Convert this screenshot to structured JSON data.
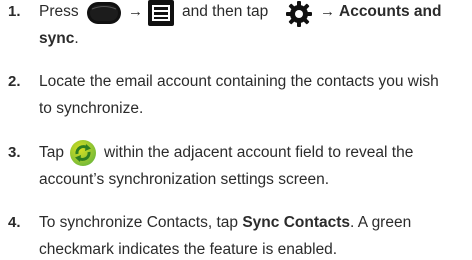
{
  "steps": [
    {
      "number": "1.",
      "press": "Press",
      "arrow1": "→",
      "middle": "and then tap",
      "arrow2": "→",
      "target_a": "Accounts and",
      "target_b": "sync",
      "period": ".",
      "icons": [
        "power-button-icon",
        "menu-key-icon",
        "settings-gear-icon"
      ]
    },
    {
      "number": "2.",
      "line1": "Locate the email account containing the contacts you wish",
      "line2": "to synchronize."
    },
    {
      "number": "3.",
      "tap": "Tap",
      "rest1": "within the adjacent account field to reveal the",
      "line2": "account’s synchronization settings screen.",
      "icon": "sync-icon"
    },
    {
      "number": "4.",
      "line1_a": "To synchronize Contacts, tap",
      "line1_b": "Sync Contacts",
      "line1_c": ". A green",
      "line2": "checkmark indicates the feature is enabled."
    }
  ],
  "colors": {
    "text": "#2b2b2b",
    "sync_green": "#7cc242",
    "sync_yellow": "#d9e021"
  }
}
